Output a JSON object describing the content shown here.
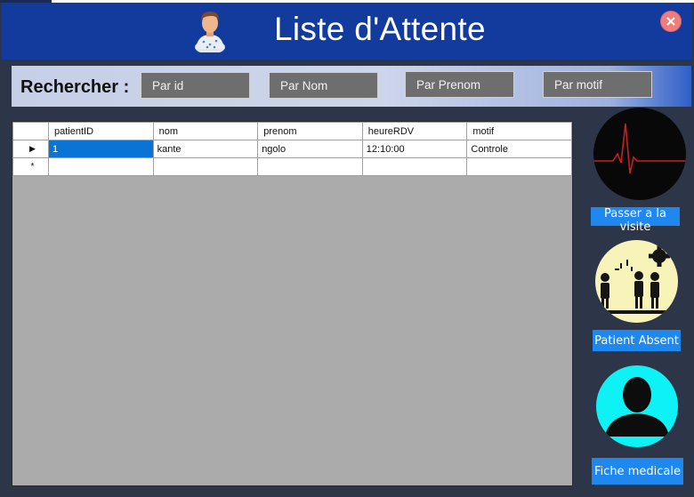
{
  "window": {
    "title": "Liste d'Attente",
    "close_icon": "close-icon"
  },
  "search": {
    "label": "Rechercher :",
    "by_id_placeholder": "Par id",
    "by_nom_placeholder": "Par Nom",
    "by_prenom_placeholder": "Par Prenom",
    "by_motif_placeholder": "Par motif"
  },
  "grid": {
    "columns": [
      "patientID",
      "nom",
      "prenom",
      "heureRDV",
      "motif"
    ],
    "rows": [
      {
        "patientID": "1",
        "nom": "kante",
        "prenom": "ngolo",
        "heureRDV": "12:10:00",
        "motif": "Controle"
      }
    ],
    "current_row_marker": "▶",
    "new_row_marker": "*"
  },
  "actions": {
    "visit_label": "Passer a la visite",
    "absent_label": "Patient Absent",
    "record_label": "Fiche medicale"
  },
  "colors": {
    "header": "#133a9d",
    "button": "#1e88ef",
    "selected_cell": "#0a73d6",
    "grid_bg": "#ababab"
  },
  "icons": {
    "header": "patient-icon",
    "visit": "heartbeat-icon",
    "absent": "absent-patients-icon",
    "record": "person-silhouette-icon"
  }
}
